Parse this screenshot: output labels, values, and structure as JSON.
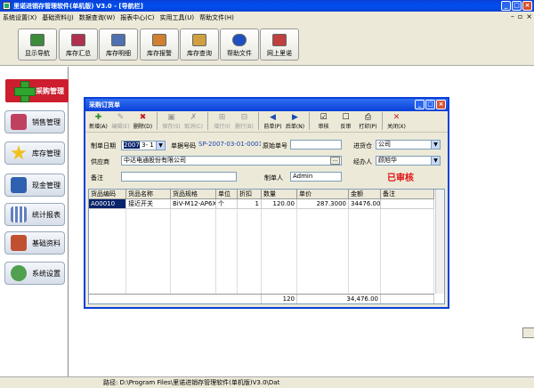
{
  "window": {
    "title": "里诺进销存管理软件(单机版) V3.0 - [导航栏]",
    "min": "_",
    "max": "□",
    "close": "×"
  },
  "menu": {
    "items": [
      "系统设置(X)",
      "基础资料(J)",
      "数据查询(W)",
      "报表中心(C)",
      "实用工具(U)",
      "帮助文件(H)"
    ],
    "mdi": [
      "–",
      "▫",
      "×"
    ]
  },
  "toolbar": {
    "buttons": [
      {
        "label": "显示导航",
        "icon": "navigation-icon",
        "color": "#3c8c3c"
      },
      {
        "label": "库存汇总",
        "icon": "stock-summary-icon",
        "color": "#b03050"
      },
      {
        "label": "库存明细",
        "icon": "stock-detail-icon",
        "color": "#5070b0"
      },
      {
        "label": "库存报警",
        "icon": "stock-alarm-icon",
        "color": "#d08030"
      },
      {
        "label": "库存查询",
        "icon": "stock-query-icon",
        "color": "#d0a040"
      },
      {
        "label": "帮助文件",
        "icon": "help-icon",
        "color": "#2050c0"
      },
      {
        "label": "网上里诺",
        "icon": "web-icon",
        "color": "#c04040"
      }
    ]
  },
  "sidebar": {
    "active": {
      "label": "采购管理",
      "icon": "plus-icon"
    },
    "items": [
      {
        "label": "销售管理",
        "icon": "sales-icon",
        "color": "#c04060"
      },
      {
        "label": "库存管理",
        "icon": "star-icon",
        "color": "#f0c020"
      },
      {
        "label": "现金管理",
        "icon": "cash-icon",
        "color": "#3060b0"
      },
      {
        "label": "统计报表",
        "icon": "report-icon",
        "color": "#6080c0"
      },
      {
        "label": "基础资料",
        "icon": "basic-data-icon",
        "color": "#c05030"
      },
      {
        "label": "系统设置",
        "icon": "settings-icon",
        "color": "#50a050"
      }
    ]
  },
  "status": {
    "path": "路径: D:\\Program Files\\里诺进销存管理软件(单机版)V3.0\\Dat"
  },
  "dialog": {
    "title": "采购订货单",
    "toolbar": [
      {
        "label": "新增(A)",
        "icon": "✚",
        "disabled": false
      },
      {
        "label": "编辑(E)",
        "icon": "✎",
        "disabled": true
      },
      {
        "label": "删除(D)",
        "icon": "✖",
        "disabled": false
      },
      {
        "label": "保存(S)",
        "icon": "▣",
        "disabled": true
      },
      {
        "label": "取消(C)",
        "icon": "✗",
        "disabled": true
      },
      {
        "label": "增行(I)",
        "icon": "⊞",
        "disabled": true
      },
      {
        "label": "删行(B)",
        "icon": "⊟",
        "disabled": true
      },
      {
        "label": "前单(P)",
        "icon": "◀",
        "disabled": false
      },
      {
        "label": "后单(N)",
        "icon": "▶",
        "disabled": false
      },
      {
        "label": "审核",
        "icon": "☑",
        "disabled": false
      },
      {
        "label": "反审",
        "icon": "☐",
        "disabled": false
      },
      {
        "label": "打印(P)",
        "icon": "⎙",
        "disabled": false
      },
      {
        "label": "关闭(X)",
        "icon": "✕",
        "disabled": false
      }
    ],
    "form": {
      "date_label": "制单日期",
      "date_year": "2007",
      "date_month": "3-",
      "date_day": "1",
      "bill_no_label": "单据号码",
      "bill_no": "SP-2007-03-01-0001",
      "original_no_label": "原始单号",
      "original_no": "",
      "warehouse_label": "进货仓",
      "warehouse": "公司",
      "supplier_label": "供应商",
      "supplier": "中达电通股份有限公司",
      "handler_label": "经办人",
      "handler": "顾旭华",
      "remark_label": "备注",
      "remark": "",
      "maker_label": "制单人",
      "maker": "Admin",
      "audit_status": "已审核"
    },
    "grid": {
      "columns": [
        "货品编码",
        "货品名称",
        "货品规格",
        "单位",
        "折扣",
        "数量",
        "单价",
        "金额",
        "备注"
      ],
      "rows": [
        {
          "code": "A00010",
          "name": "接近开关",
          "spec": "BiV-M12-AP6X-H",
          "unit": "个",
          "discount": "1",
          "qty": "120.00",
          "price": "287.3000",
          "amount": "34476.00",
          "remark": ""
        }
      ],
      "footer": {
        "qty": "120",
        "amount": "34,476.00"
      }
    }
  }
}
